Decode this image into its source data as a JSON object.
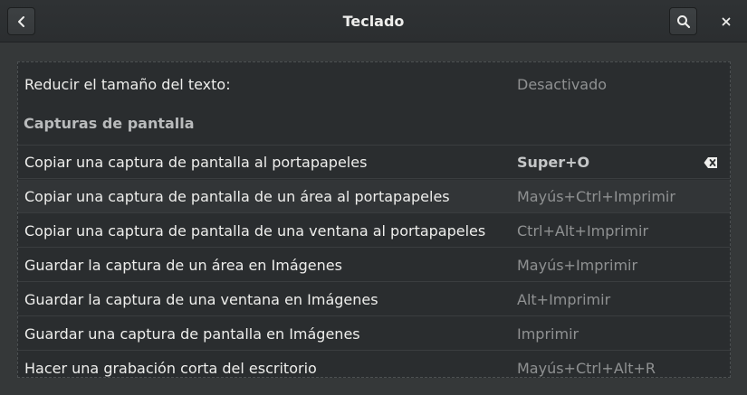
{
  "header": {
    "title": "Teclado",
    "back_icon": "go-back-icon",
    "search_icon": "search-icon",
    "close_icon": "close-icon"
  },
  "text_size_row": {
    "label": "Reducir el tamaño del texto:",
    "value": "Desactivado"
  },
  "section": {
    "title": "Capturas de pantalla"
  },
  "shortcuts": [
    {
      "label": "Copiar una captura de pantalla al portapapeles",
      "accel": "Super+O"
    },
    {
      "label": "Copiar una captura de pantalla de un área al portapapeles",
      "accel": "Mayús+Ctrl+Imprimir"
    },
    {
      "label": "Copiar una captura de pantalla de una ventana al portapapeles",
      "accel": "Ctrl+Alt+Imprimir"
    },
    {
      "label": "Guardar la captura de un área en Imágenes",
      "accel": "Mayús+Imprimir"
    },
    {
      "label": "Guardar la captura de una ventana en Imágenes",
      "accel": "Alt+Imprimir"
    },
    {
      "label": "Guardar una captura de pantalla en Imágenes",
      "accel": "Imprimir"
    },
    {
      "label": "Hacer una grabación corta del escritorio",
      "accel": "Mayús+Ctrl+Alt+R"
    }
  ],
  "colors": {
    "window_bg": "#353839",
    "list_bg": "#2a2d2f",
    "text": "#eeeeec",
    "dim_text": "#8f9192"
  }
}
